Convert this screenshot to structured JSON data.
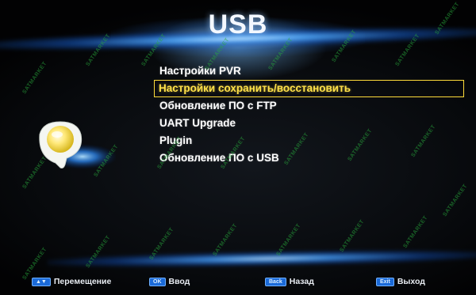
{
  "screen": {
    "title": "USB"
  },
  "menu": {
    "items": [
      {
        "label": "Настройки PVR"
      },
      {
        "label": "Настройки сохранить/восстановить"
      },
      {
        "label": "Обновление ПО с FTP"
      },
      {
        "label": "UART Upgrade"
      },
      {
        "label": "Plugin"
      },
      {
        "label": "Обновление ПО с USB"
      }
    ],
    "selected_index": 1
  },
  "footer": {
    "move": {
      "key": "▲▼",
      "label": "Перемещение"
    },
    "enter": {
      "key": "OK",
      "label": "Ввод"
    },
    "back": {
      "key": "Back",
      "label": "Назад"
    },
    "exit": {
      "key": "Exit",
      "label": "Выход"
    }
  },
  "watermark": {
    "text": "SATMARKET"
  },
  "colors": {
    "selected_text": "#ffe14a",
    "selected_border": "#ffdc3a",
    "key_badge": "#1b6ad8",
    "glow": "#4aa8ff"
  }
}
